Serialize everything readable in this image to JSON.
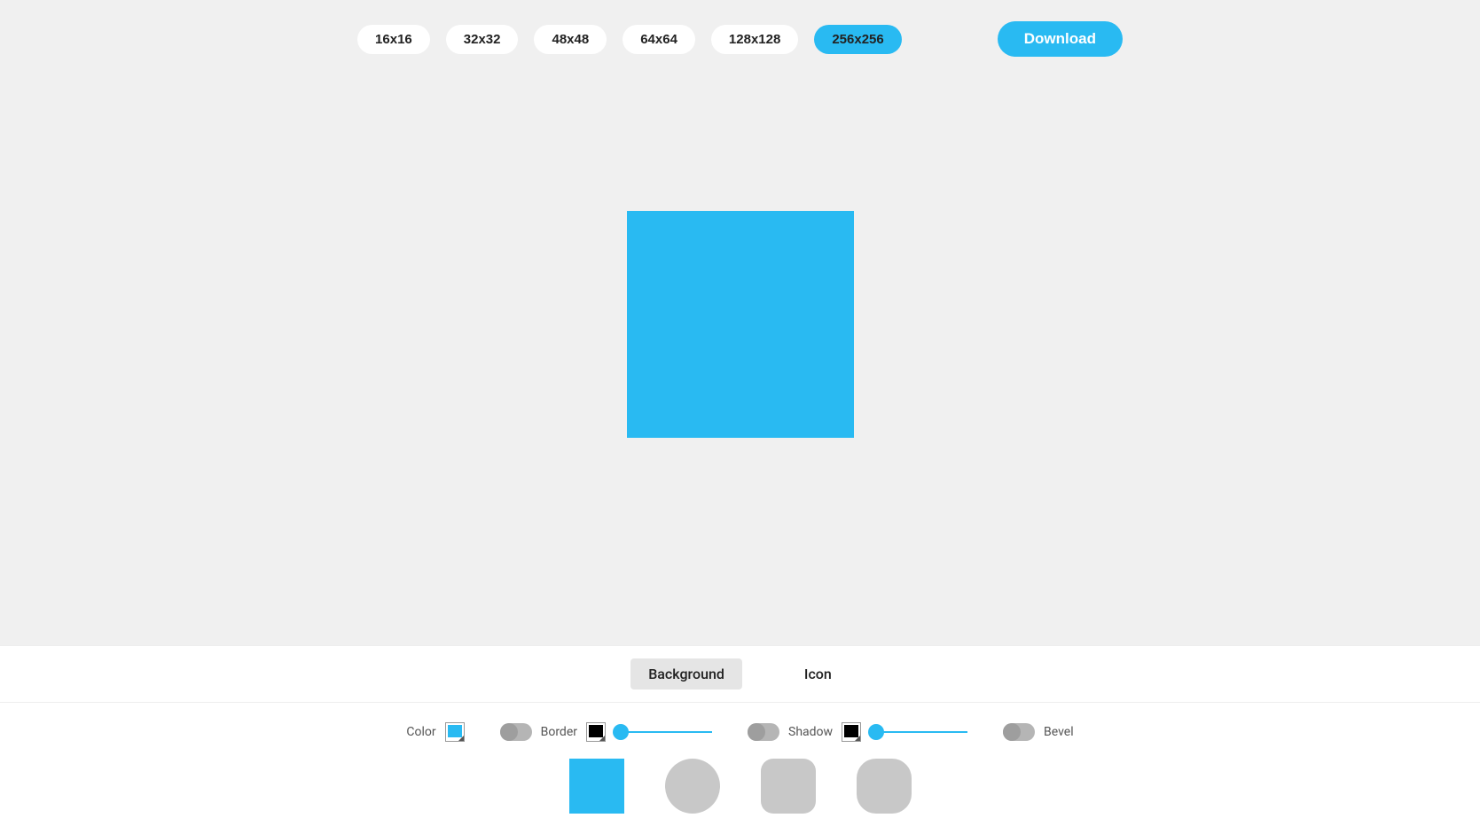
{
  "sizes": {
    "options": [
      "16x16",
      "32x32",
      "48x48",
      "64x64",
      "128x128",
      "256x256"
    ],
    "active_index": 5
  },
  "download_label": "Download",
  "preview": {
    "color": "#29baf2"
  },
  "tabs": {
    "background_label": "Background",
    "icon_label": "Icon",
    "active": "background"
  },
  "controls": {
    "color_label": "Color",
    "color_value": "#29baf2",
    "border_label": "Border",
    "border_on": false,
    "border_color": "#000000",
    "border_slider": 0,
    "shadow_label": "Shadow",
    "shadow_on": false,
    "shadow_color": "#000000",
    "shadow_slider": 0,
    "bevel_label": "Bevel",
    "bevel_on": false
  },
  "shapes": {
    "active_index": 0
  }
}
